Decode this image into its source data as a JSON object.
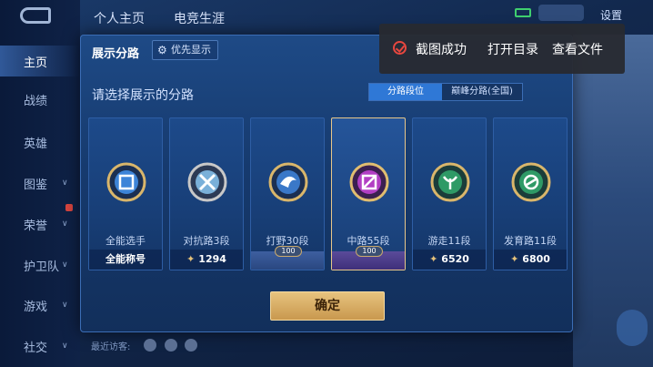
{
  "sidebar": {
    "items": [
      {
        "label": "主页",
        "active": true
      },
      {
        "label": "战绩"
      },
      {
        "label": "英雄"
      },
      {
        "label": "图鉴"
      },
      {
        "label": "荣誉"
      },
      {
        "label": "护卫队"
      },
      {
        "label": "游戏"
      },
      {
        "label": "社交"
      }
    ]
  },
  "top": {
    "tabs": [
      "个人主页",
      "电竞生涯"
    ],
    "settings": "设置"
  },
  "dialog": {
    "title": "展示分路",
    "priority_label": "优先显示",
    "prompt": "请选择展示的分路",
    "segments": [
      {
        "label": "分路段位",
        "active": true
      },
      {
        "label": "巅峰分路(全国)",
        "active": false
      }
    ],
    "confirm": "确定",
    "cards": [
      {
        "name": "全能选手",
        "foot": "全能称号",
        "badge_color": "#3d84d8",
        "selected": false
      },
      {
        "name": "对抗路3段",
        "foot": "1294",
        "badge_color": "#7ab0d9",
        "selected": false
      },
      {
        "name": "打野30段",
        "foot": "",
        "pill": "100",
        "badge_color": "#3a78c8",
        "selected": false
      },
      {
        "name": "中路55段",
        "foot": "",
        "pill": "100",
        "badge_color": "#b23fc4",
        "selected": true
      },
      {
        "name": "游走11段",
        "foot": "6520",
        "badge_color": "#2f9a66",
        "selected": false
      },
      {
        "name": "发育路11段",
        "foot": "6800",
        "badge_color": "#2f9a66",
        "selected": false
      }
    ]
  },
  "footer": {
    "recent_label": "最近访客:"
  },
  "toast": {
    "message": "截图成功",
    "action_open_dir": "打开目录",
    "action_view_file": "查看文件"
  },
  "colors": {
    "accent_gold": "#e6c37e",
    "selected_border": "#e8c78a",
    "toast_icon": "#e8473f"
  }
}
